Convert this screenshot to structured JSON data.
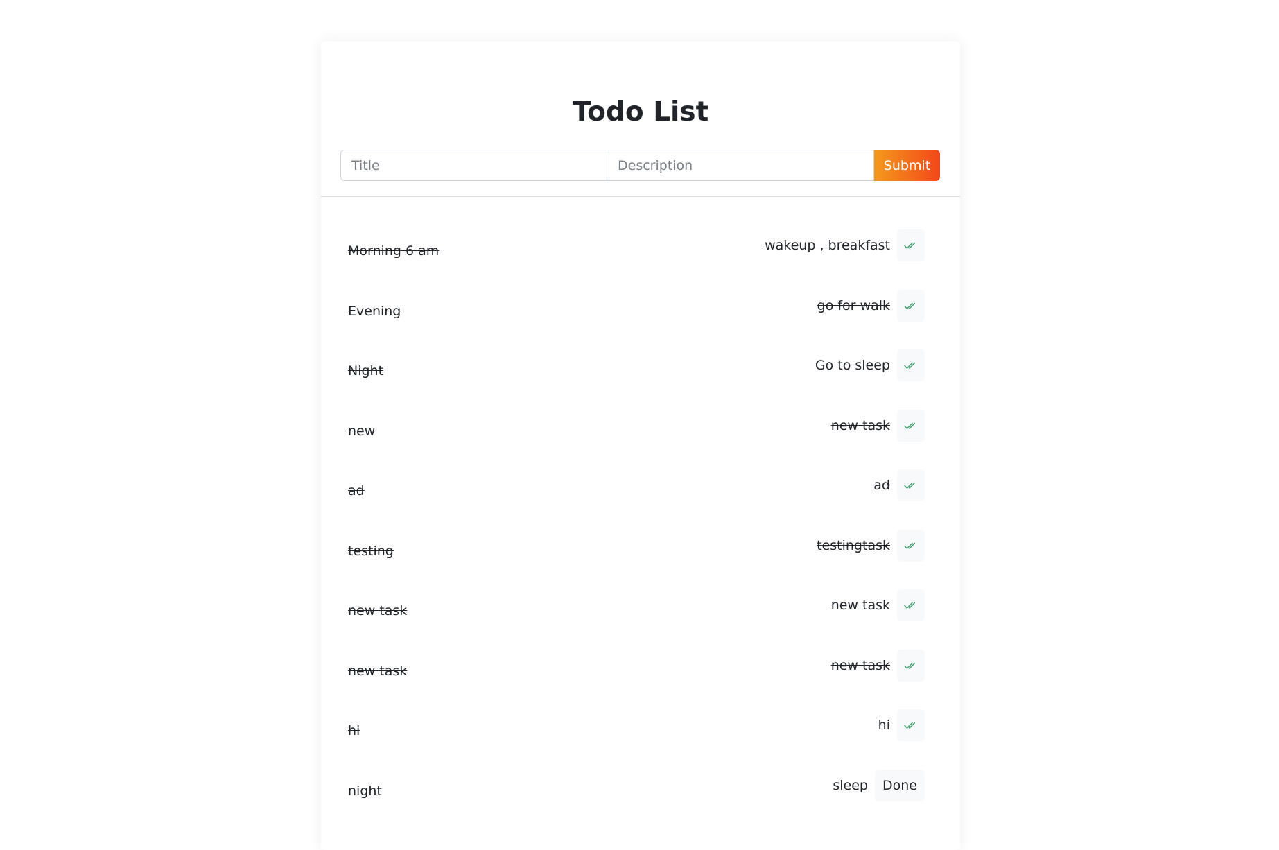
{
  "header": {
    "title": "Todo List"
  },
  "form": {
    "title_placeholder": "Title",
    "description_placeholder": "Description",
    "submit_label": "Submit"
  },
  "todos": [
    {
      "title": "Morning 6 am",
      "description": "wakeup , breakfast",
      "completed": true
    },
    {
      "title": "Evening",
      "description": "go for walk",
      "completed": true
    },
    {
      "title": "Night",
      "description": "Go to sleep",
      "completed": true
    },
    {
      "title": "new",
      "description": "new task",
      "completed": true
    },
    {
      "title": "ad",
      "description": "ad",
      "completed": true
    },
    {
      "title": "testing",
      "description": "testingtask",
      "completed": true
    },
    {
      "title": "new task",
      "description": "new task",
      "completed": true
    },
    {
      "title": "new task",
      "description": "new task",
      "completed": true
    },
    {
      "title": "hi",
      "description": "hi",
      "completed": true
    },
    {
      "title": "night",
      "description": "sleep",
      "completed": false,
      "action_label": "Done"
    }
  ],
  "icons": {
    "completed": "double-check-icon"
  },
  "colors": {
    "submit_gradient_start": "#f59a1c",
    "submit_gradient_end": "#f2471a",
    "check_icon": "#3a9a6a"
  }
}
